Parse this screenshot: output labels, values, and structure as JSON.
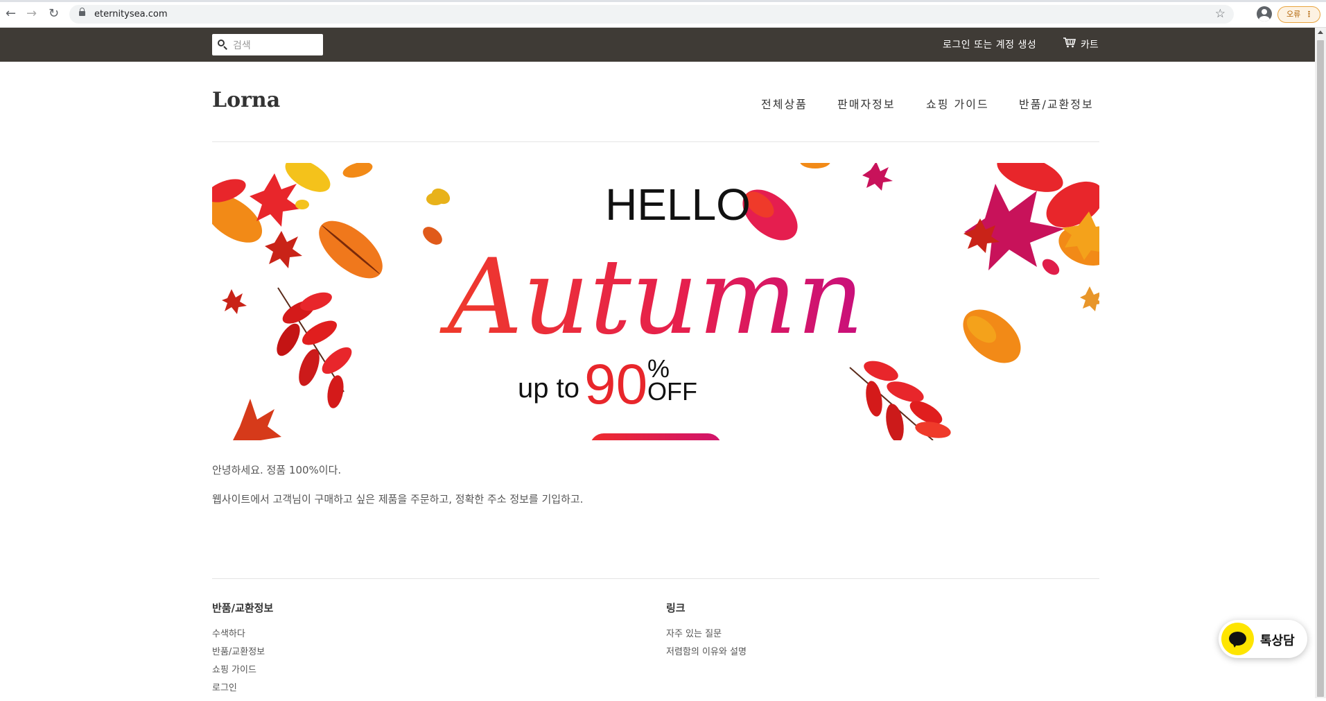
{
  "browser": {
    "url": "eternitysea.com",
    "error_label": "오류",
    "back_icon": "arrow-left-icon",
    "forward_icon": "arrow-right-icon",
    "reload_icon": "reload-icon"
  },
  "topbar": {
    "search_placeholder": "검색",
    "login_label": "로그인 또는 계정 생성",
    "cart_label": "카트"
  },
  "header": {
    "logo": "Lorna",
    "nav": [
      "전체상품",
      "판매자정보",
      "쇼핑 가이드",
      "반품/교환정보"
    ]
  },
  "banner": {
    "hello": "HELLO",
    "autumn": "Autumn",
    "up_to": "up to",
    "percent": "90",
    "percent_sign": "%",
    "off": "OFF",
    "colors": {
      "red": "#e8262b",
      "magenta": "#d4146a",
      "orange": "#f28a17",
      "yellow": "#f4c21b"
    }
  },
  "content": {
    "line1": "안녕하세요. 정품 100%이다.",
    "line2": "웹사이트에서 고객님이 구매하고 싶은 제품을 주문하고, 정확한 주소 정보를 기입하고."
  },
  "footer": {
    "col1": {
      "heading": "반품/교환정보",
      "links": [
        "수색하다",
        "반품/교환정보",
        "쇼핑 가이드",
        "로그인"
      ]
    },
    "col2": {
      "heading": "링크",
      "links": [
        "자주 있는 질문",
        "저렴함의 이유와 설명"
      ]
    }
  },
  "chat": {
    "label": "톡상담",
    "accent": "#fee500"
  }
}
